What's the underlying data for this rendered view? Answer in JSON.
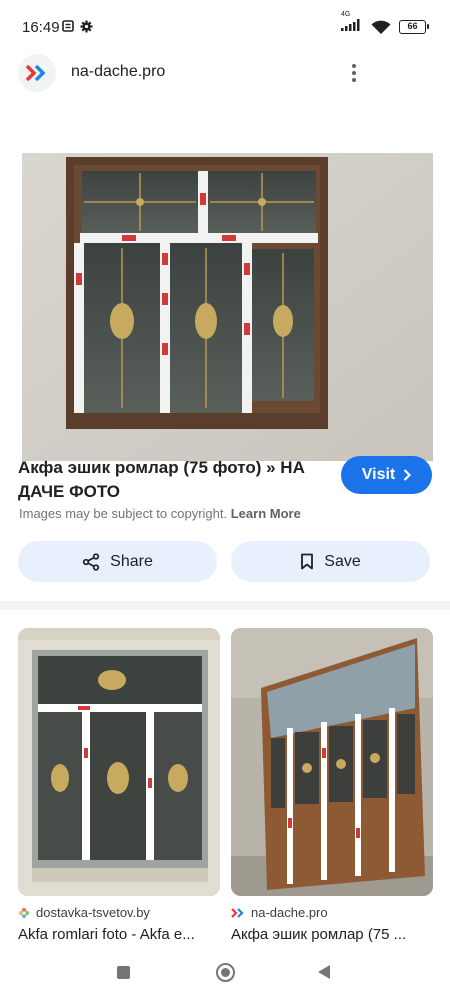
{
  "status_bar": {
    "time": "16:49",
    "network": "4G",
    "battery": "66"
  },
  "header": {
    "site_name": "na-dache.pro",
    "favicon_icon": "chevron-double-right-icon"
  },
  "result": {
    "title": "Акфа эшик ромлар (75 фото) » НА ДАЧЕ ФОТО",
    "visit_label": "Visit",
    "copyright_text": "Images may be subject to copyright.",
    "learn_more_label": "Learn More"
  },
  "actions": {
    "share_label": "Share",
    "save_label": "Save"
  },
  "related": [
    {
      "source": "dostavka-tsvetov.by",
      "title": "Akfa romlari foto - Akfa e...",
      "favicon_icon": "flower-icon"
    },
    {
      "source": "na-dache.pro",
      "title": "Акфа эшик ромлар (75 ...",
      "favicon_icon": "chevron-double-right-icon"
    }
  ],
  "colors": {
    "accent": "#1a73e8",
    "chip_bg": "#e8f0fe",
    "favicon_red": "#e53935",
    "favicon_blue": "#1e88e5"
  }
}
